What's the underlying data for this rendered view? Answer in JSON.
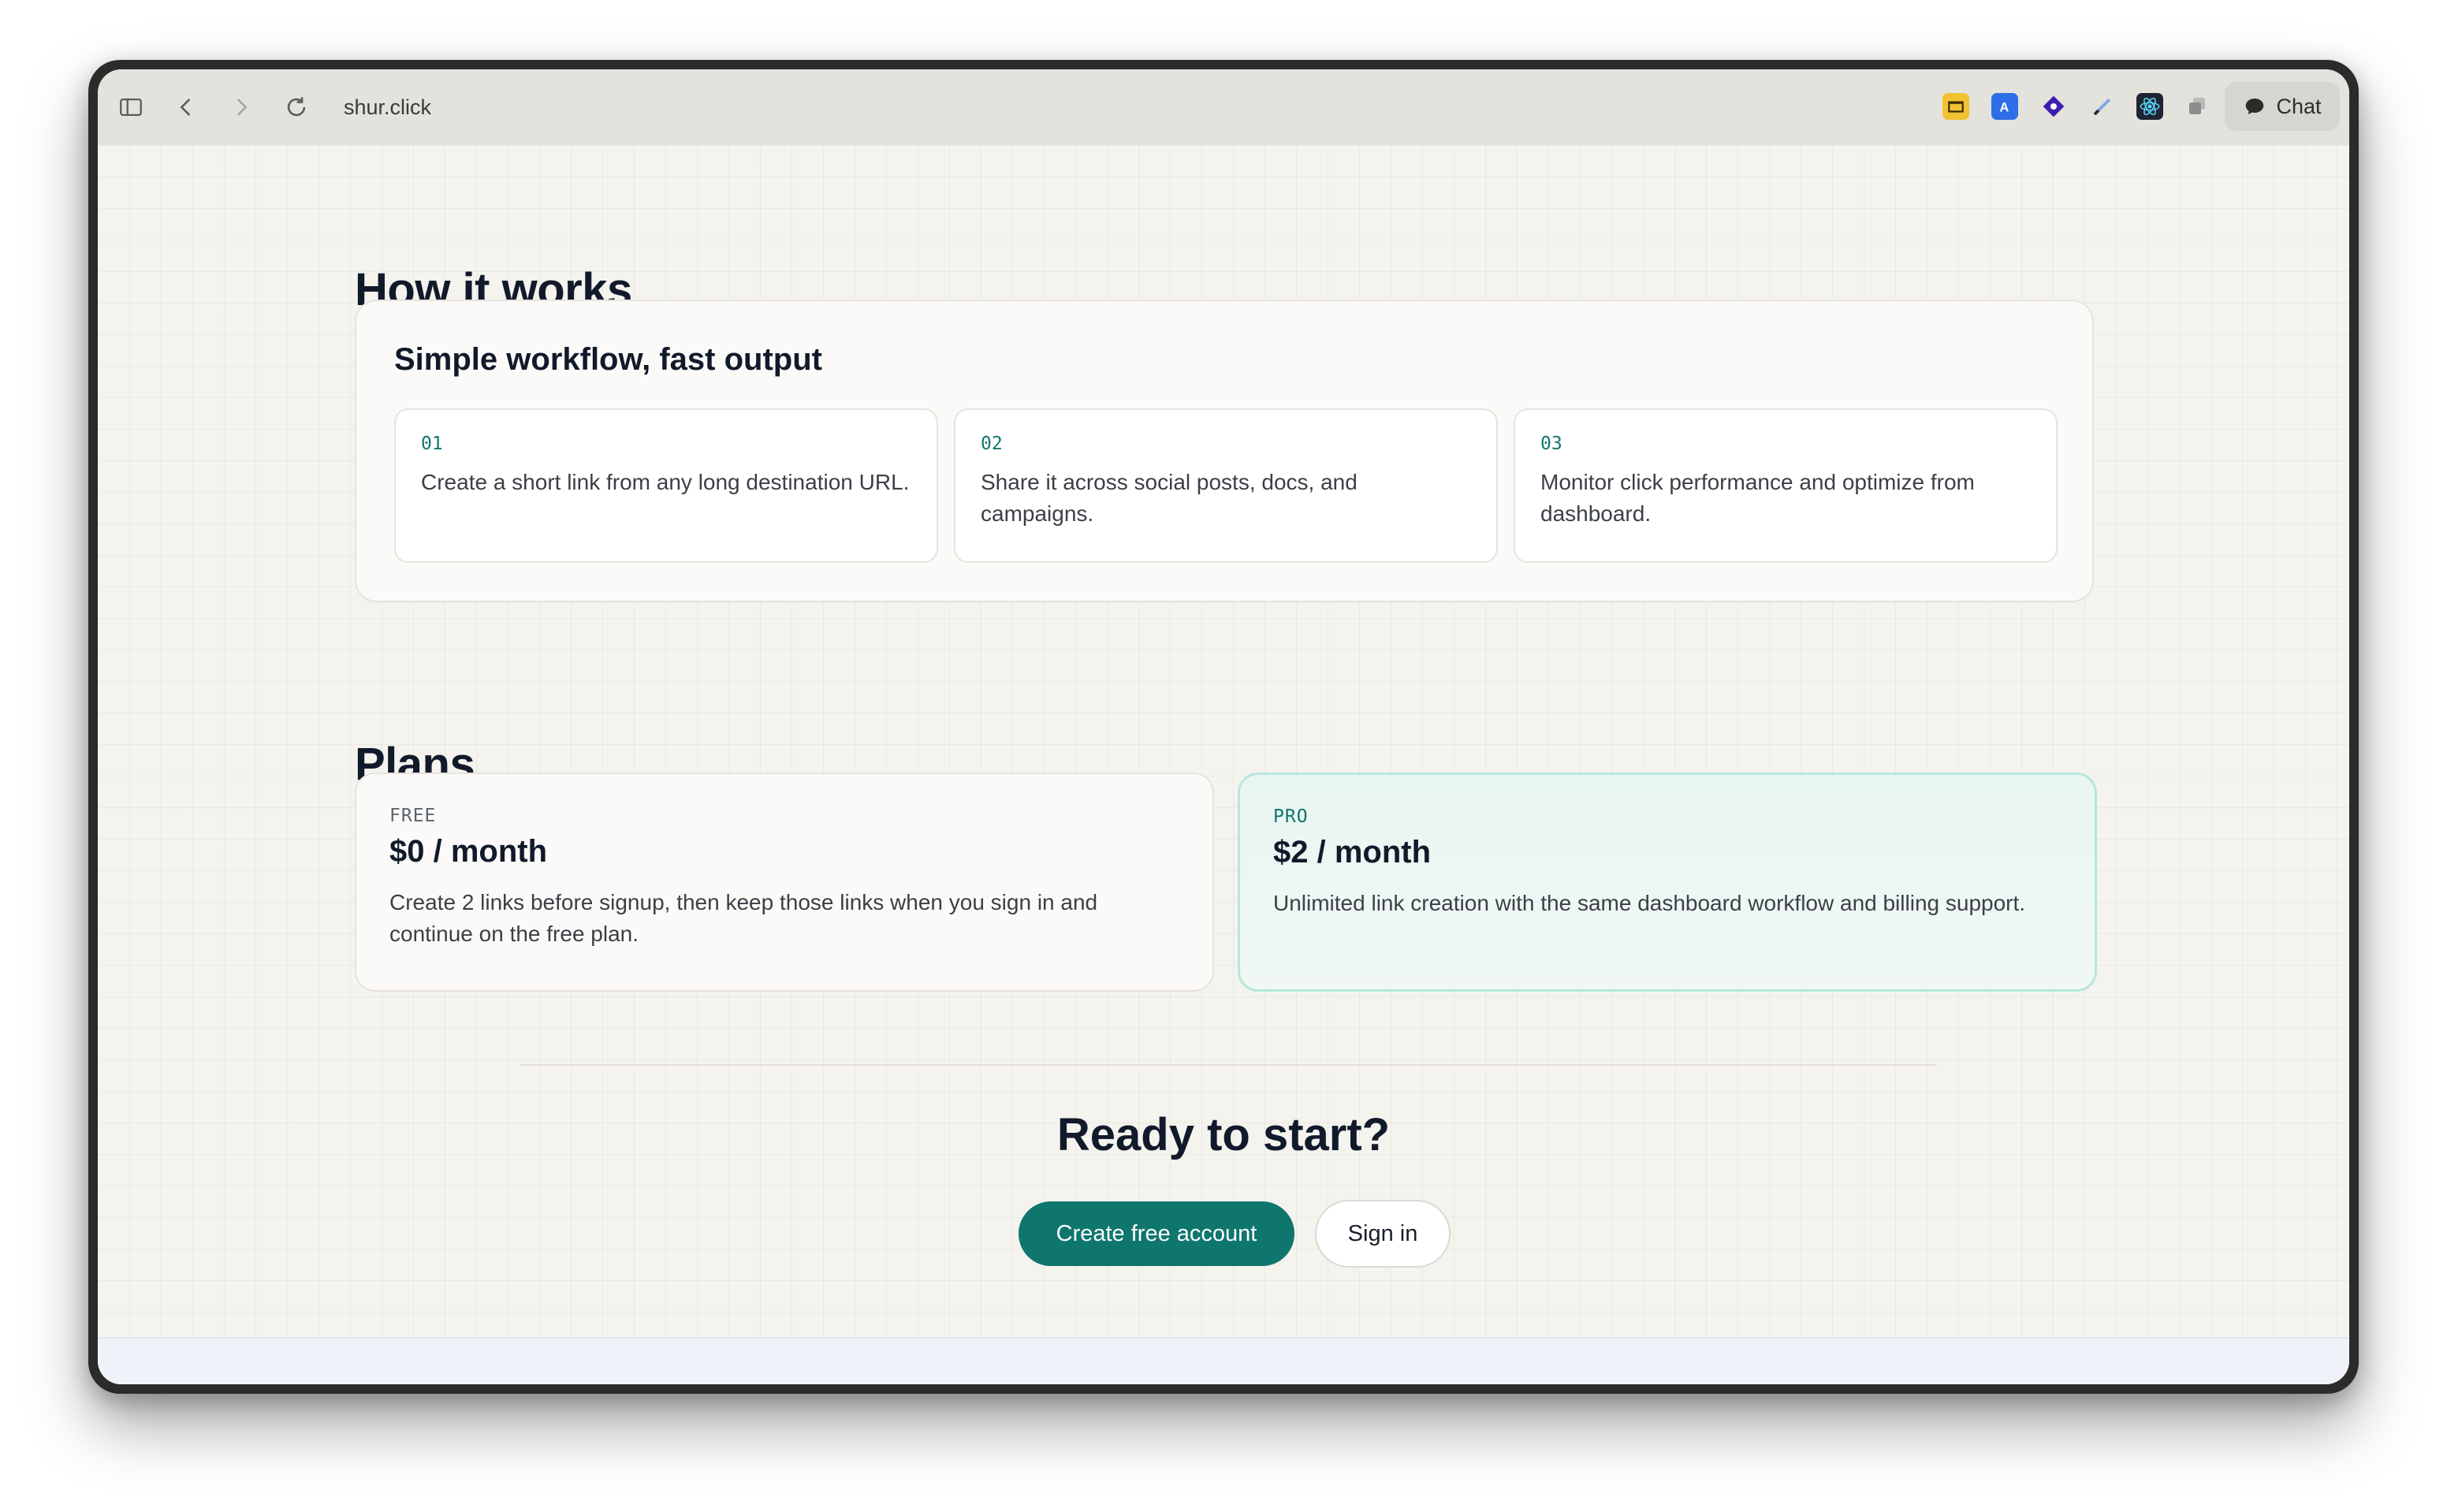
{
  "browser": {
    "url": "shur.click",
    "chat_label": "Chat",
    "icons": [
      "sidebar-toggle-icon",
      "back-icon",
      "forward-icon",
      "reload-icon"
    ],
    "extensions": [
      "folder-extension-icon",
      "translate-extension-icon",
      "diamond-extension-icon",
      "pen-extension-icon",
      "react-devtools-icon",
      "stack-extension-icon"
    ]
  },
  "how_it_works": {
    "title": "How it works",
    "card_title": "Simple workflow, fast output",
    "steps": [
      {
        "num": "01",
        "text": "Create a short link from any long destination URL."
      },
      {
        "num": "02",
        "text": "Share it across social posts, docs, and campaigns."
      },
      {
        "num": "03",
        "text": "Monitor click performance and optimize from dashboard."
      }
    ]
  },
  "plans": {
    "title": "Plans",
    "items": [
      {
        "tier": "FREE",
        "price": "$0 / month",
        "desc": "Create 2 links before signup, then keep those links when you sign in and continue on the free plan."
      },
      {
        "tier": "PRO",
        "price": "$2 / month",
        "desc": "Unlimited link creation with the same dashboard workflow and billing support."
      }
    ]
  },
  "cta": {
    "title": "Ready to start?",
    "primary_label": "Create free account",
    "secondary_label": "Sign in"
  },
  "colors": {
    "accent": "#0f766e",
    "page_bg": "#f5f3ee",
    "heading": "#111a2b"
  }
}
